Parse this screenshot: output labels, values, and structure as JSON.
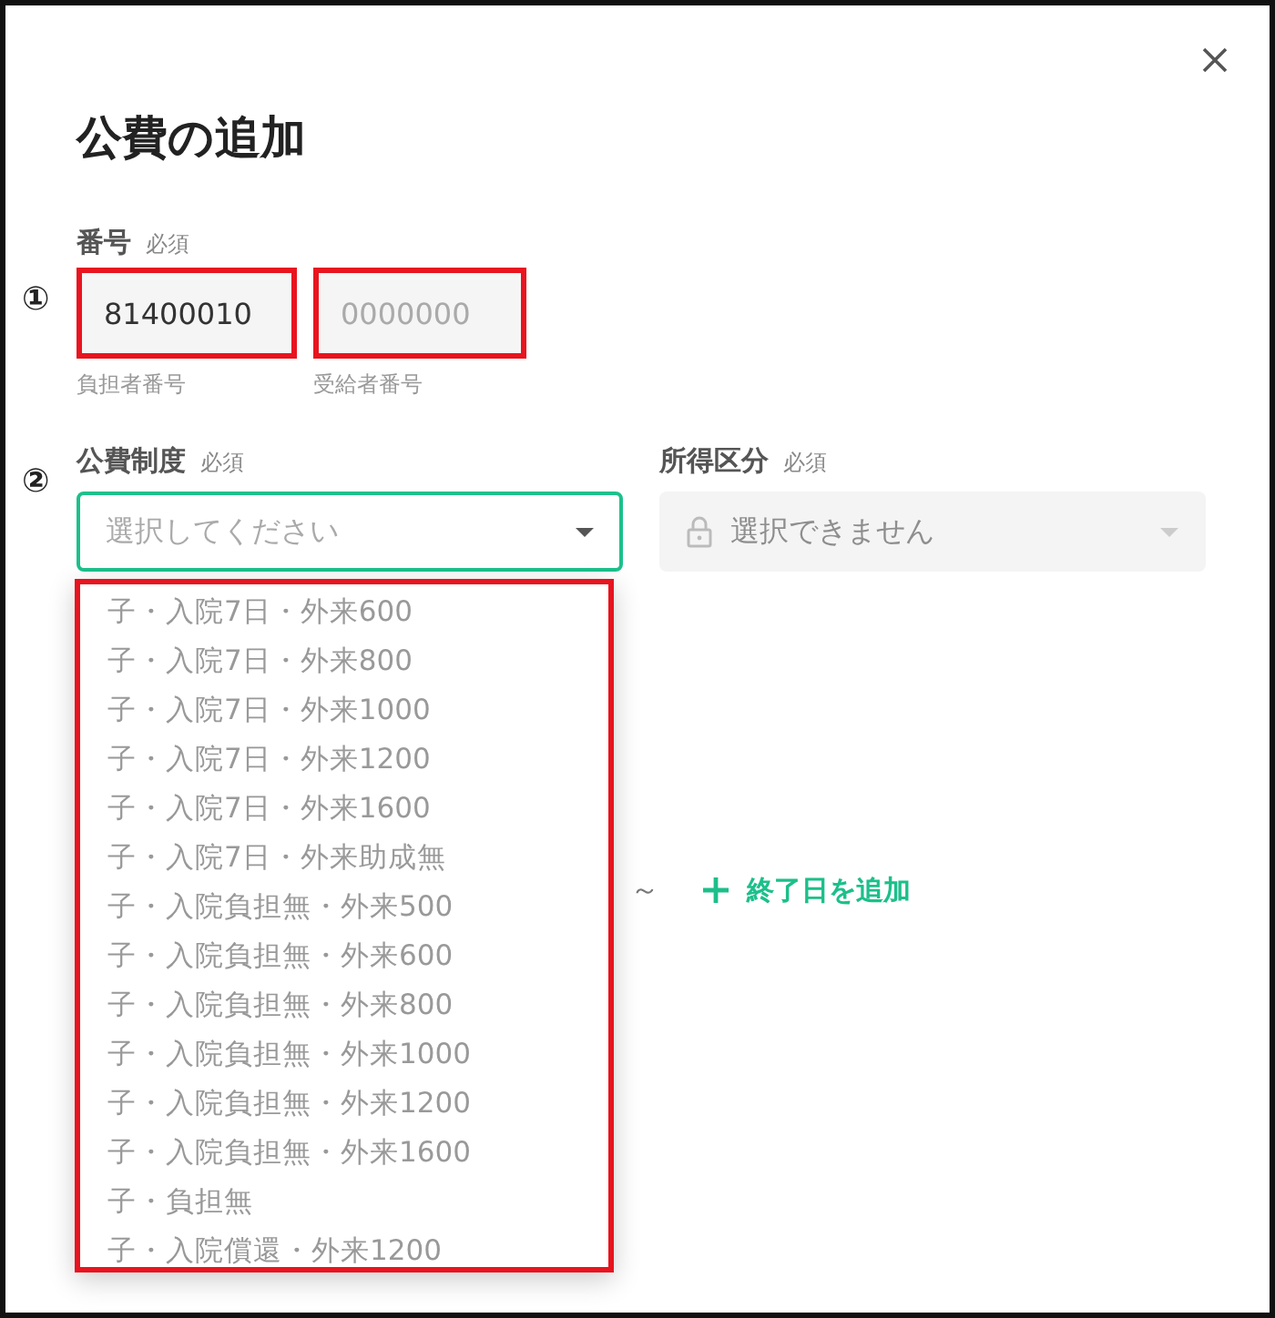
{
  "dialog": {
    "title": "公費の追加"
  },
  "number": {
    "label": "番号",
    "required": "必須",
    "annotation": "①",
    "fields": [
      {
        "value": "81400010",
        "helper": "負担者番号",
        "highlighted": true
      },
      {
        "placeholder": "0000000",
        "helper": "受給者番号",
        "highlighted": true
      }
    ]
  },
  "system": {
    "label": "公費制度",
    "required": "必須",
    "annotation": "②",
    "placeholder": "選択してください",
    "focused": true,
    "expanded": true,
    "options_highlighted": true,
    "options": [
      "子・入院7日・外来600",
      "子・入院7日・外来800",
      "子・入院7日・外来1000",
      "子・入院7日・外来1200",
      "子・入院7日・外来1600",
      "子・入院7日・外来助成無",
      "子・入院負担無・外来500",
      "子・入院負担無・外来600",
      "子・入院負担無・外来800",
      "子・入院負担無・外来1000",
      "子・入院負担無・外来1200",
      "子・入院負担無・外来1600",
      "子・負担無",
      "子・入院償還・外来1200"
    ]
  },
  "income": {
    "label": "所得区分",
    "required": "必須",
    "placeholder": "選択できません",
    "disabled": true
  },
  "period": {
    "separator": "～",
    "add_end_date": "終了日を追加"
  }
}
